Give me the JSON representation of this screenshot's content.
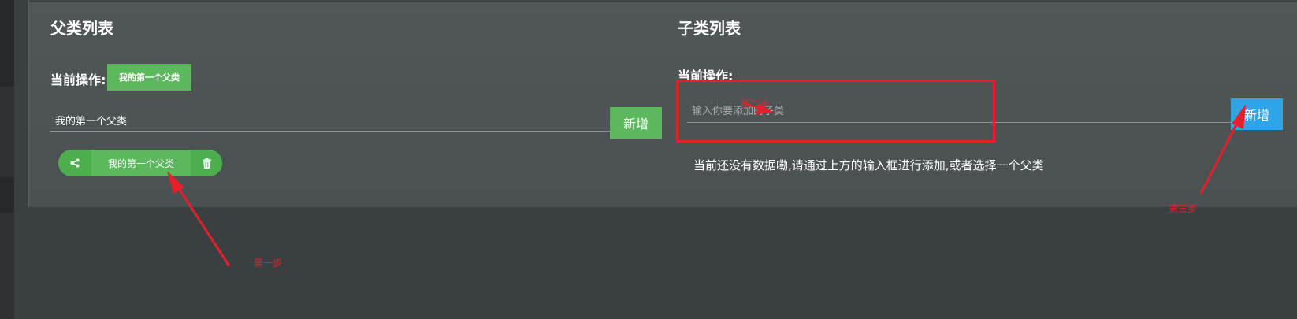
{
  "parent_section": {
    "title": "父类列表",
    "current_op_label": "当前操作:",
    "current_op_value": "我的第一个父类",
    "input_value": "我的第一个父类",
    "add_button": "新增",
    "items": [
      {
        "label": "我的第一个父类"
      }
    ]
  },
  "child_section": {
    "title": "子类列表",
    "current_op_label": "当前操作:",
    "input_placeholder": "输入你要添加的子类",
    "add_button": "新增",
    "empty_message": "当前还没有数据嘞,请通过上方的输入框进行添加,或者选择一个父类"
  },
  "annotations": {
    "step1": "第一步",
    "step2": "第二步",
    "step3": "第三步"
  },
  "colors": {
    "panel_bg": "#4f5557",
    "page_bg": "#3a3f42",
    "success": "#5cb85c",
    "primary": "#2fa4e7",
    "annotation_red": "#e5202a"
  },
  "icons": {
    "share": "share-icon",
    "trash": "trash-icon"
  }
}
